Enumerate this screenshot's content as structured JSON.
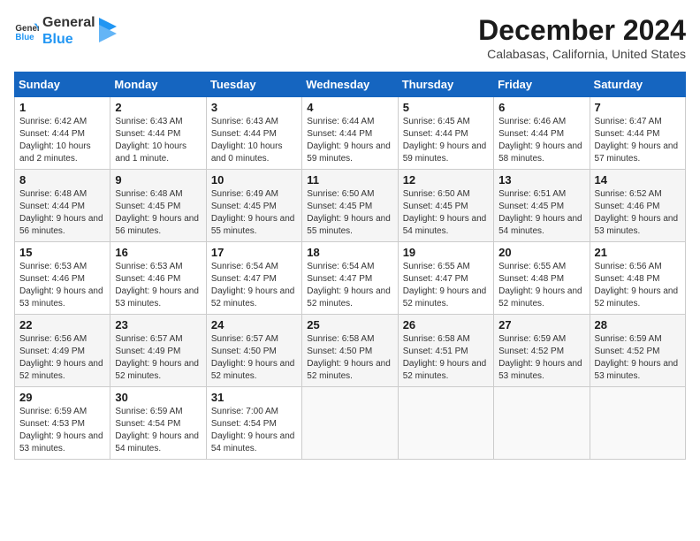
{
  "logo": {
    "line1": "General",
    "line2": "Blue"
  },
  "title": "December 2024",
  "location": "Calabasas, California, United States",
  "weekdays": [
    "Sunday",
    "Monday",
    "Tuesday",
    "Wednesday",
    "Thursday",
    "Friday",
    "Saturday"
  ],
  "weeks": [
    [
      {
        "day": "1",
        "sunrise": "6:42 AM",
        "sunset": "4:44 PM",
        "daylight": "10 hours and 2 minutes."
      },
      {
        "day": "2",
        "sunrise": "6:43 AM",
        "sunset": "4:44 PM",
        "daylight": "10 hours and 1 minute."
      },
      {
        "day": "3",
        "sunrise": "6:43 AM",
        "sunset": "4:44 PM",
        "daylight": "10 hours and 0 minutes."
      },
      {
        "day": "4",
        "sunrise": "6:44 AM",
        "sunset": "4:44 PM",
        "daylight": "9 hours and 59 minutes."
      },
      {
        "day": "5",
        "sunrise": "6:45 AM",
        "sunset": "4:44 PM",
        "daylight": "9 hours and 59 minutes."
      },
      {
        "day": "6",
        "sunrise": "6:46 AM",
        "sunset": "4:44 PM",
        "daylight": "9 hours and 58 minutes."
      },
      {
        "day": "7",
        "sunrise": "6:47 AM",
        "sunset": "4:44 PM",
        "daylight": "9 hours and 57 minutes."
      }
    ],
    [
      {
        "day": "8",
        "sunrise": "6:48 AM",
        "sunset": "4:44 PM",
        "daylight": "9 hours and 56 minutes."
      },
      {
        "day": "9",
        "sunrise": "6:48 AM",
        "sunset": "4:45 PM",
        "daylight": "9 hours and 56 minutes."
      },
      {
        "day": "10",
        "sunrise": "6:49 AM",
        "sunset": "4:45 PM",
        "daylight": "9 hours and 55 minutes."
      },
      {
        "day": "11",
        "sunrise": "6:50 AM",
        "sunset": "4:45 PM",
        "daylight": "9 hours and 55 minutes."
      },
      {
        "day": "12",
        "sunrise": "6:50 AM",
        "sunset": "4:45 PM",
        "daylight": "9 hours and 54 minutes."
      },
      {
        "day": "13",
        "sunrise": "6:51 AM",
        "sunset": "4:45 PM",
        "daylight": "9 hours and 54 minutes."
      },
      {
        "day": "14",
        "sunrise": "6:52 AM",
        "sunset": "4:46 PM",
        "daylight": "9 hours and 53 minutes."
      }
    ],
    [
      {
        "day": "15",
        "sunrise": "6:53 AM",
        "sunset": "4:46 PM",
        "daylight": "9 hours and 53 minutes."
      },
      {
        "day": "16",
        "sunrise": "6:53 AM",
        "sunset": "4:46 PM",
        "daylight": "9 hours and 53 minutes."
      },
      {
        "day": "17",
        "sunrise": "6:54 AM",
        "sunset": "4:47 PM",
        "daylight": "9 hours and 52 minutes."
      },
      {
        "day": "18",
        "sunrise": "6:54 AM",
        "sunset": "4:47 PM",
        "daylight": "9 hours and 52 minutes."
      },
      {
        "day": "19",
        "sunrise": "6:55 AM",
        "sunset": "4:47 PM",
        "daylight": "9 hours and 52 minutes."
      },
      {
        "day": "20",
        "sunrise": "6:55 AM",
        "sunset": "4:48 PM",
        "daylight": "9 hours and 52 minutes."
      },
      {
        "day": "21",
        "sunrise": "6:56 AM",
        "sunset": "4:48 PM",
        "daylight": "9 hours and 52 minutes."
      }
    ],
    [
      {
        "day": "22",
        "sunrise": "6:56 AM",
        "sunset": "4:49 PM",
        "daylight": "9 hours and 52 minutes."
      },
      {
        "day": "23",
        "sunrise": "6:57 AM",
        "sunset": "4:49 PM",
        "daylight": "9 hours and 52 minutes."
      },
      {
        "day": "24",
        "sunrise": "6:57 AM",
        "sunset": "4:50 PM",
        "daylight": "9 hours and 52 minutes."
      },
      {
        "day": "25",
        "sunrise": "6:58 AM",
        "sunset": "4:50 PM",
        "daylight": "9 hours and 52 minutes."
      },
      {
        "day": "26",
        "sunrise": "6:58 AM",
        "sunset": "4:51 PM",
        "daylight": "9 hours and 52 minutes."
      },
      {
        "day": "27",
        "sunrise": "6:59 AM",
        "sunset": "4:52 PM",
        "daylight": "9 hours and 53 minutes."
      },
      {
        "day": "28",
        "sunrise": "6:59 AM",
        "sunset": "4:52 PM",
        "daylight": "9 hours and 53 minutes."
      }
    ],
    [
      {
        "day": "29",
        "sunrise": "6:59 AM",
        "sunset": "4:53 PM",
        "daylight": "9 hours and 53 minutes."
      },
      {
        "day": "30",
        "sunrise": "6:59 AM",
        "sunset": "4:54 PM",
        "daylight": "9 hours and 54 minutes."
      },
      {
        "day": "31",
        "sunrise": "7:00 AM",
        "sunset": "4:54 PM",
        "daylight": "9 hours and 54 minutes."
      },
      null,
      null,
      null,
      null
    ]
  ]
}
